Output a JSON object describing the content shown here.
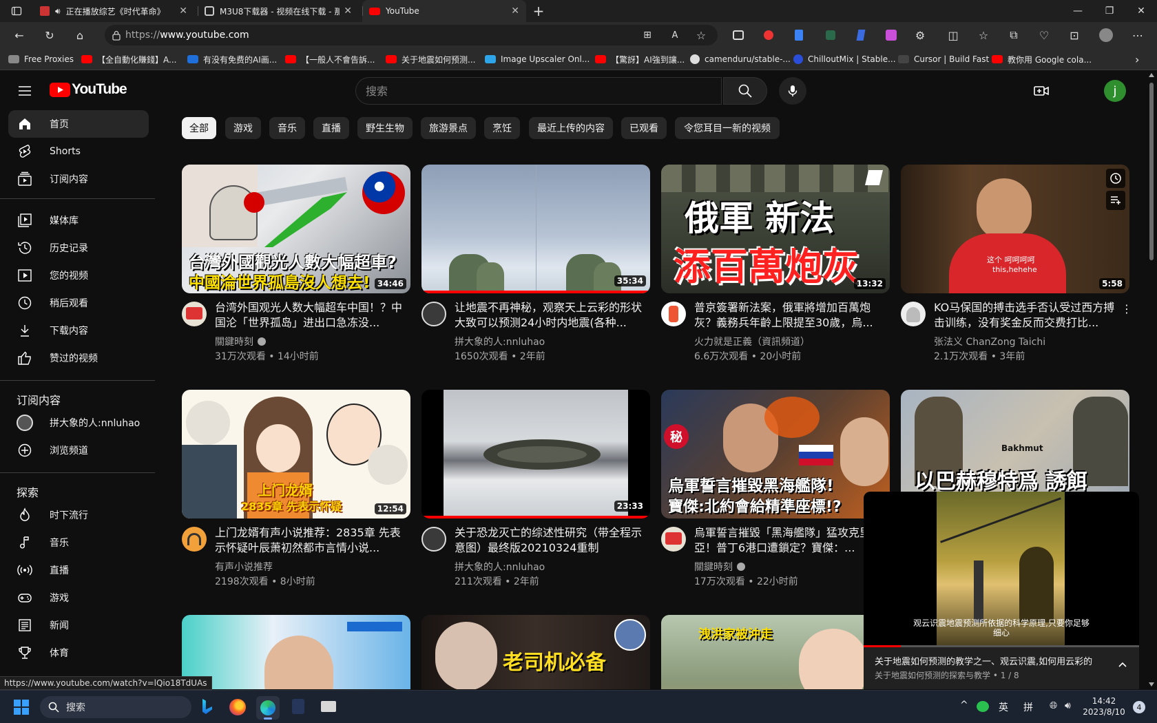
{
  "browser": {
    "tabs": [
      {
        "title": "正在播放综艺《时代革命》",
        "favicon_color": "#c33"
      },
      {
        "title": "M3U8下载器 - 视频在线下载 - 那",
        "favicon_color": "#555"
      },
      {
        "title": "YouTube",
        "favicon_color": "#f00"
      }
    ],
    "url_proto": "https://",
    "url_host": "www.youtube.com",
    "bookmarks": [
      {
        "label": "Free Proxies",
        "color": "#888"
      },
      {
        "label": "【全自動化賺錢】A...",
        "color": "#f00"
      },
      {
        "label": "有没有免费的AI画...",
        "color": "#1e6fd9"
      },
      {
        "label": "【一般人不會告訴...",
        "color": "#f00"
      },
      {
        "label": "关于地震如何预测...",
        "color": "#f00"
      },
      {
        "label": "Image Upscaler Onl...",
        "color": "#2da5e8"
      },
      {
        "label": "【驚訝】AI強到讓...",
        "color": "#f00"
      },
      {
        "label": "camenduru/stable-...",
        "color": "#ddd"
      },
      {
        "label": "ChilloutMix | Stable...",
        "color": "#2a4ed8"
      },
      {
        "label": "Cursor | Build Fast",
        "color": "#222"
      },
      {
        "label": "教你用 Google cola...",
        "color": "#f00"
      }
    ]
  },
  "youtube": {
    "logo_text": "YouTube",
    "search_placeholder": "搜索",
    "avatar_letter": "j",
    "sidebar": {
      "main": [
        "首页",
        "Shorts",
        "订阅内容"
      ],
      "library": [
        "媒体库",
        "历史记录",
        "您的视频",
        "稍后观看",
        "下载内容",
        "赞过的视频"
      ],
      "subs_heading": "订阅内容",
      "subs": [
        "拼大象的人:nnluhao",
        "浏览频道"
      ],
      "explore_heading": "探索",
      "explore": [
        "时下流行",
        "音乐",
        "直播",
        "游戏",
        "新闻",
        "体育"
      ]
    },
    "chips": [
      "全部",
      "游戏",
      "音乐",
      "直播",
      "野生生物",
      "旅游景点",
      "烹饪",
      "最近上传的内容",
      "已观看",
      "令您耳目一新的视频"
    ],
    "videos": [
      {
        "title": "台湾外国观光人数大幅超车中国！？中国沦「世界孤岛」进出口急冻没...",
        "channel": "關鍵時刻",
        "verified": true,
        "meta": "31万次观看 • 14小时前",
        "duration": "34:46",
        "progress": 0,
        "thumb_lines": [
          "台灣外國觀光人數大幅超車?",
          "中國淪世界孤島沒人想去!"
        ]
      },
      {
        "title": "让地震不再神秘，观察天上云彩的形状大致可以预测24小时内地震(各种...",
        "channel": "拼大象的人:nnluhao",
        "verified": false,
        "meta": "1650次观看 • 2年前",
        "duration": "35:34",
        "progress": 1.0,
        "thumb_lines": []
      },
      {
        "title": "普京簽署新法案，俄軍將增加百萬炮灰？義務兵年齡上限提至30歲，烏...",
        "channel": "火力就是正義（資訊頻道）",
        "verified": false,
        "meta": "6.6万次观看 • 20小时前",
        "duration": "13:32",
        "progress": 0,
        "thumb_lines": [
          "俄軍 新法",
          "添百萬炮灰"
        ]
      },
      {
        "title": "KO马保国的搏击选手否认受过西方搏击训练，没有奖金反而交费打比...",
        "channel": "张法义 ChanZong Taichi",
        "verified": false,
        "meta": "2.1万次观看 • 3年前",
        "duration": "5:58",
        "progress": 0,
        "thumb_lines": [
          "这个 呵呵呵呵",
          "this,hehehe"
        ]
      },
      {
        "title": "上门龙婿有声小说推荐：2835章 先表示怀疑叶辰萧初然都市言情小说...",
        "channel": "有声小说推荐",
        "verified": false,
        "meta": "2198次观看 • 8小时前",
        "duration": "12:54",
        "progress": 0,
        "thumb_lines": [
          "上门龙婿",
          "2835章 先表示怀疑"
        ]
      },
      {
        "title": "关于恐龙灭亡的综述性研究（带全程示意图）最终版20210324重制",
        "channel": "拼大象的人:nnluhao",
        "verified": false,
        "meta": "211次观看 • 2年前",
        "duration": "23:33",
        "progress": 1.0,
        "thumb_lines": []
      },
      {
        "title": "烏軍誓言摧毀「黑海艦隊」猛攻克里米亞！普丁6港口遭鎖定？寶傑：...",
        "channel": "關鍵時刻",
        "verified": true,
        "meta": "17万次观看 • 22小时前",
        "duration": "",
        "progress": 0,
        "thumb_lines": [
          "烏軍誓言摧毀黑海艦隊!",
          "寶傑:北約會給精準座標!?"
        ]
      },
      {
        "title": "",
        "channel": "",
        "verified": false,
        "meta": "",
        "duration": "",
        "progress": 0,
        "thumb_lines": [
          "以巴赫穆特爲 誘餌",
          "Bakhmut"
        ]
      },
      {
        "title": "",
        "channel": "",
        "verified": false,
        "meta": "",
        "duration": "",
        "progress": 0,
        "thumb_lines": []
      },
      {
        "title": "",
        "channel": "",
        "verified": false,
        "meta": "",
        "duration": "",
        "progress": 0,
        "thumb_lines": [
          "老司机必备"
        ]
      },
      {
        "title": "",
        "channel": "",
        "verified": false,
        "meta": "",
        "duration": "",
        "progress": 0,
        "thumb_lines": [
          "洩洪家被沖走"
        ]
      }
    ],
    "miniplayer": {
      "caption_1": "观云识震地震预测所依据的科学原理,只要你足够",
      "caption_2": "细心",
      "title": "关于地震如何预测的教学之一、观云识震,如何用云彩的",
      "subtitle": "关于地震如何预测的探索与教学 • 1 / 8"
    },
    "status_url": "https://www.youtube.com/watch?v=lQio18TdUAs"
  },
  "taskbar": {
    "search_label": "搜索",
    "ime_1": "英",
    "ime_2": "拼",
    "time": "14:42",
    "date": "2023/8/10",
    "notifications": "4"
  }
}
